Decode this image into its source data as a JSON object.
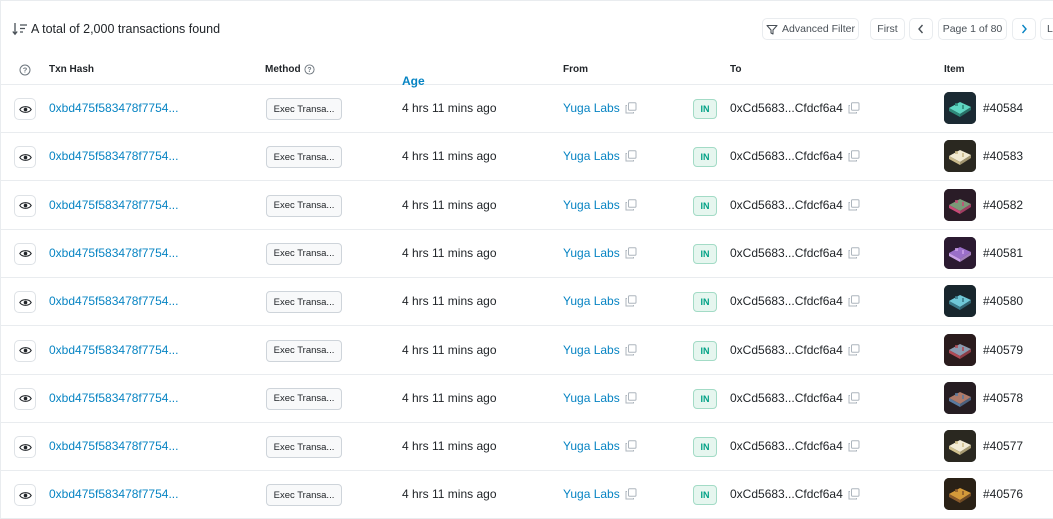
{
  "summary": {
    "text": "A total of 2,000 transactions found",
    "icon": "sort-descending-icon"
  },
  "toolbar": {
    "advanced_filter": "Advanced Filter",
    "first": "First",
    "page_info": "Page 1 of 80",
    "last": "L"
  },
  "columns": {
    "help": "?",
    "txn_hash": "Txn Hash",
    "method": "Method",
    "age": "Age",
    "from": "From",
    "to": "To",
    "item": "Item"
  },
  "colors": {
    "link": "#0784c3",
    "in_badge_bg": "#e6f6ef",
    "in_badge_text": "#00a186",
    "border": "#e9ecef"
  },
  "rows": [
    {
      "hash": "0xbd475f583478f7754...",
      "method": "Exec Transa...",
      "age": "4 hrs 11 mins ago",
      "from": "Yuga Labs",
      "direction": "IN",
      "to": "0xCd5683...Cfdcf6a4",
      "item": "#40584",
      "thumb": {
        "bg": "#1b2a33",
        "fg": "#5fd6c2",
        "accent": "#2e8a7a"
      }
    },
    {
      "hash": "0xbd475f583478f7754...",
      "method": "Exec Transa...",
      "age": "4 hrs 11 mins ago",
      "from": "Yuga Labs",
      "direction": "IN",
      "to": "0xCd5683...Cfdcf6a4",
      "item": "#40583",
      "thumb": {
        "bg": "#2a2820",
        "fg": "#f1ead2",
        "accent": "#c9b98a"
      }
    },
    {
      "hash": "0xbd475f583478f7754...",
      "method": "Exec Transa...",
      "age": "4 hrs 11 mins ago",
      "from": "Yuga Labs",
      "direction": "IN",
      "to": "0xCd5683...Cfdcf6a4",
      "item": "#40582",
      "thumb": {
        "bg": "#2a1c27",
        "fg": "#7a9a78",
        "accent": "#c84a77"
      }
    },
    {
      "hash": "0xbd475f583478f7754...",
      "method": "Exec Transa...",
      "age": "4 hrs 11 mins ago",
      "from": "Yuga Labs",
      "direction": "IN",
      "to": "0xCd5683...Cfdcf6a4",
      "item": "#40581",
      "thumb": {
        "bg": "#2b1a31",
        "fg": "#9a6fc9",
        "accent": "#c9a0e8"
      }
    },
    {
      "hash": "0xbd475f583478f7754...",
      "method": "Exec Transa...",
      "age": "4 hrs 11 mins ago",
      "from": "Yuga Labs",
      "direction": "IN",
      "to": "0xCd5683...Cfdcf6a4",
      "item": "#40580",
      "thumb": {
        "bg": "#18262d",
        "fg": "#6fc8d8",
        "accent": "#3a7a8a"
      }
    },
    {
      "hash": "0xbd475f583478f7754...",
      "method": "Exec Transa...",
      "age": "4 hrs 11 mins ago",
      "from": "Yuga Labs",
      "direction": "IN",
      "to": "0xCd5683...Cfdcf6a4",
      "item": "#40579",
      "thumb": {
        "bg": "#2a1b1d",
        "fg": "#8a9ab0",
        "accent": "#b04a55"
      }
    },
    {
      "hash": "0xbd475f583478f7754...",
      "method": "Exec Transa...",
      "age": "4 hrs 11 mins ago",
      "from": "Yuga Labs",
      "direction": "IN",
      "to": "0xCd5683...Cfdcf6a4",
      "item": "#40578",
      "thumb": {
        "bg": "#261d22",
        "fg": "#b07a6a",
        "accent": "#5a7aa0"
      }
    },
    {
      "hash": "0xbd475f583478f7754...",
      "method": "Exec Transa...",
      "age": "4 hrs 11 mins ago",
      "from": "Yuga Labs",
      "direction": "IN",
      "to": "0xCd5683...Cfdcf6a4",
      "item": "#40577",
      "thumb": {
        "bg": "#2a2820",
        "fg": "#f3ecd6",
        "accent": "#d2c28e"
      }
    },
    {
      "hash": "0xbd475f583478f7754...",
      "method": "Exec Transa...",
      "age": "4 hrs 11 mins ago",
      "from": "Yuga Labs",
      "direction": "IN",
      "to": "0xCd5683...Cfdcf6a4",
      "item": "#40576",
      "thumb": {
        "bg": "#2a2116",
        "fg": "#d49a3a",
        "accent": "#8a5a2a"
      }
    }
  ]
}
